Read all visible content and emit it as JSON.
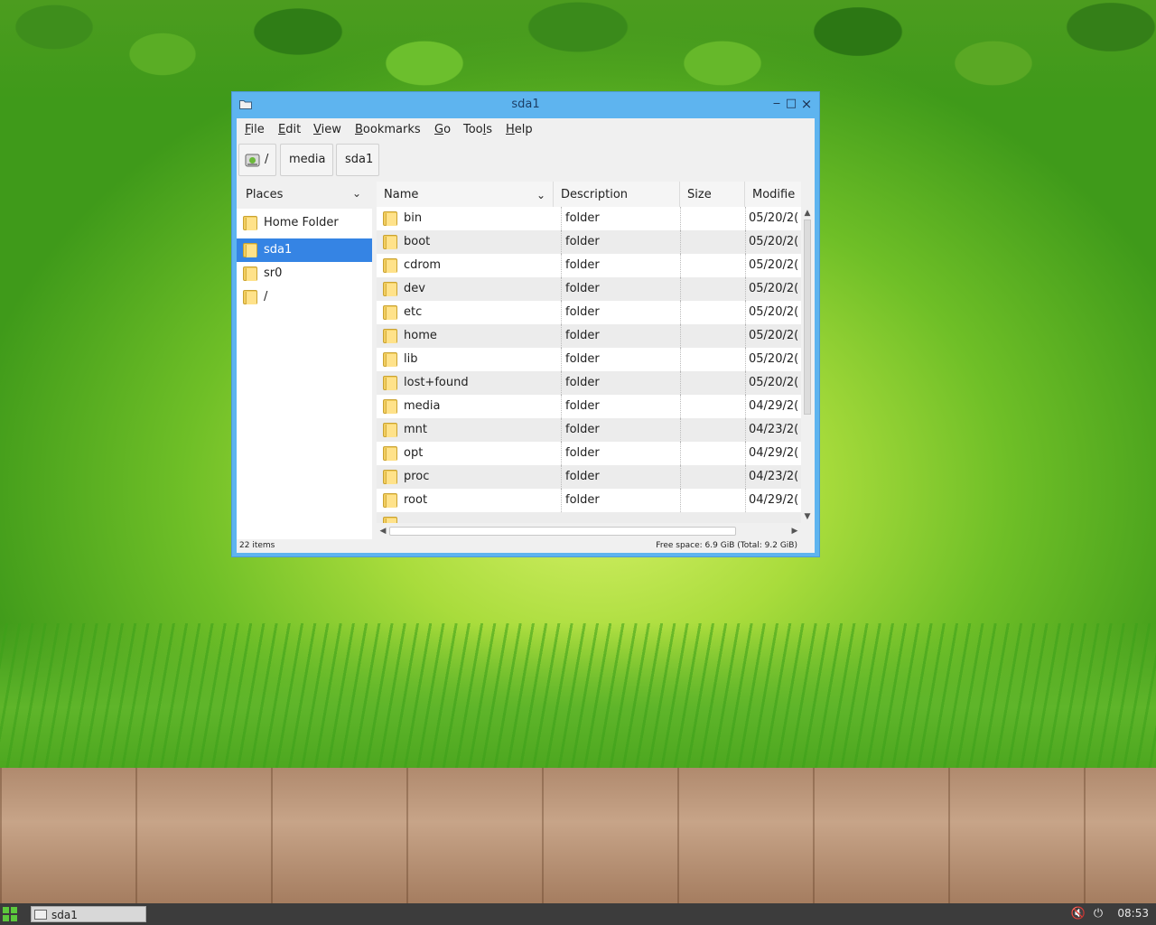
{
  "window": {
    "title": "sda1",
    "controls": {
      "minimize": "‒",
      "maximize": "□",
      "close": "×"
    }
  },
  "menubar": [
    {
      "pre": "",
      "u": "F",
      "post": "ile"
    },
    {
      "pre": "",
      "u": "E",
      "post": "dit"
    },
    {
      "pre": "",
      "u": "V",
      "post": "iew"
    },
    {
      "pre": "",
      "u": "B",
      "post": "ookmarks"
    },
    {
      "pre": "",
      "u": "G",
      "post": "o"
    },
    {
      "pre": "Too",
      "u": "l",
      "post": "s"
    },
    {
      "pre": "",
      "u": "H",
      "post": "elp"
    }
  ],
  "pathbar": {
    "root": "/",
    "crumbs": [
      "media",
      "sda1"
    ]
  },
  "places": {
    "header": "Places",
    "items": [
      {
        "label": "Home Folder",
        "selected": false
      },
      {
        "label": "sda1",
        "selected": true
      },
      {
        "label": "sr0",
        "selected": false
      },
      {
        "label": "/",
        "selected": false
      }
    ]
  },
  "filelist": {
    "columns": {
      "name": "Name",
      "description": "Description",
      "size": "Size",
      "modified": "Modifie"
    },
    "rows": [
      {
        "name": "bin",
        "description": "folder",
        "size": "",
        "modified": "05/20/2("
      },
      {
        "name": "boot",
        "description": "folder",
        "size": "",
        "modified": "05/20/2("
      },
      {
        "name": "cdrom",
        "description": "folder",
        "size": "",
        "modified": "05/20/2("
      },
      {
        "name": "dev",
        "description": "folder",
        "size": "",
        "modified": "05/20/2("
      },
      {
        "name": "etc",
        "description": "folder",
        "size": "",
        "modified": "05/20/2("
      },
      {
        "name": "home",
        "description": "folder",
        "size": "",
        "modified": "05/20/2("
      },
      {
        "name": "lib",
        "description": "folder",
        "size": "",
        "modified": "05/20/2("
      },
      {
        "name": "lost+found",
        "description": "folder",
        "size": "",
        "modified": "05/20/2("
      },
      {
        "name": "media",
        "description": "folder",
        "size": "",
        "modified": "04/29/2("
      },
      {
        "name": "mnt",
        "description": "folder",
        "size": "",
        "modified": "04/23/2("
      },
      {
        "name": "opt",
        "description": "folder",
        "size": "",
        "modified": "04/29/2("
      },
      {
        "name": "proc",
        "description": "folder",
        "size": "",
        "modified": "04/23/2("
      },
      {
        "name": "root",
        "description": "folder",
        "size": "",
        "modified": "04/29/2("
      }
    ]
  },
  "statusbar": {
    "items": "22 items",
    "free_space": "Free space: 6.9 GiB (Total: 9.2 GiB)"
  },
  "taskbar": {
    "task_label": "sda1",
    "clock": "08:53",
    "tray_icons": [
      "volume-muted-icon",
      "power-icon"
    ]
  },
  "colors": {
    "window_frame": "#5eb4ef",
    "selection": "#3584e4",
    "taskbar": "#3c3c3c"
  }
}
